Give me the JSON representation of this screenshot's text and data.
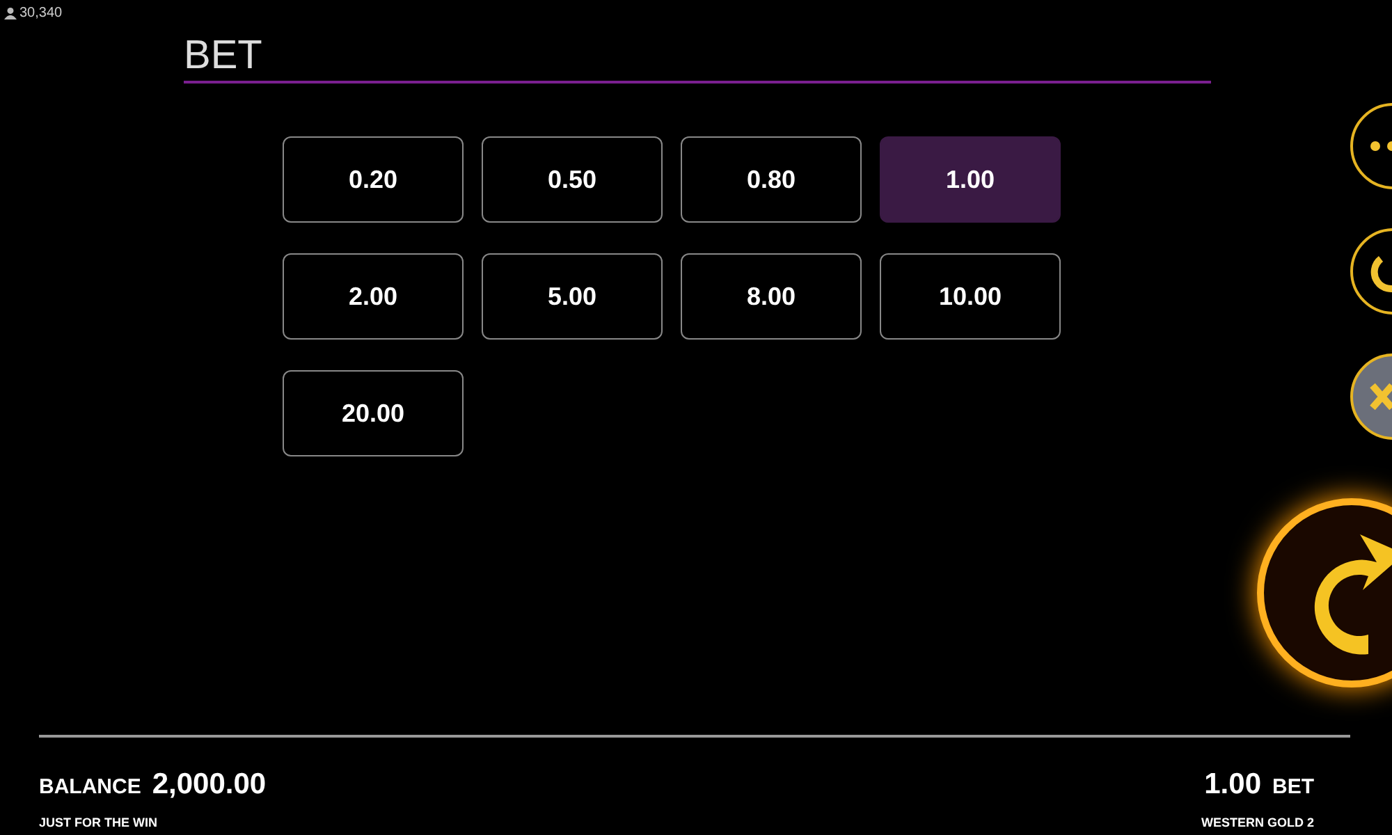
{
  "players": "30,340",
  "title": "BET",
  "bets": [
    {
      "label": "0.20",
      "selected": false
    },
    {
      "label": "0.50",
      "selected": false
    },
    {
      "label": "0.80",
      "selected": false
    },
    {
      "label": "1.00",
      "selected": true
    },
    {
      "label": "2.00",
      "selected": false
    },
    {
      "label": "5.00",
      "selected": false
    },
    {
      "label": "8.00",
      "selected": false
    },
    {
      "label": "10.00",
      "selected": false
    },
    {
      "label": "20.00",
      "selected": false
    }
  ],
  "balance": {
    "label": "BALANCE",
    "value": "2,000.00"
  },
  "bet": {
    "value": "1.00",
    "label": "BET"
  },
  "footer_left": "JUST FOR THE WIN",
  "footer_right": "WESTERN GOLD 2"
}
